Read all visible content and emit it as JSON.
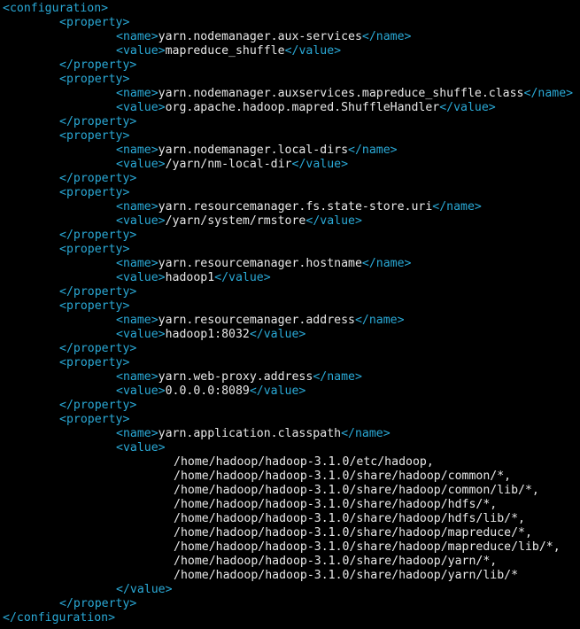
{
  "editor": {
    "root_open": "<configuration>",
    "root_close": "</configuration>",
    "prop_open": "<property>",
    "prop_close": "</property>",
    "name_open": "<name>",
    "name_close": "</name>",
    "value_open": "<value>",
    "value_close": "</value>",
    "properties": [
      {
        "name": "yarn.nodemanager.aux-services",
        "value": "mapreduce_shuffle"
      },
      {
        "name": "yarn.nodemanager.auxservices.mapreduce_shuffle.class",
        "value": "org.apache.hadoop.mapred.ShuffleHandler"
      },
      {
        "name": "yarn.nodemanager.local-dirs",
        "value": "/yarn/nm-local-dir"
      },
      {
        "name": "yarn.resourcemanager.fs.state-store.uri",
        "value": "/yarn/system/rmstore"
      },
      {
        "name": "yarn.resourcemanager.hostname",
        "value": "hadoop1"
      },
      {
        "name": "yarn.resourcemanager.address",
        "value": "hadoop1:8032"
      },
      {
        "name": "yarn.web-proxy.address",
        "value": "0.0.0.0:8089"
      }
    ],
    "classpath_property": {
      "name": "yarn.application.classpath",
      "value_lines": [
        "/home/hadoop/hadoop-3.1.0/etc/hadoop,",
        "/home/hadoop/hadoop-3.1.0/share/hadoop/common/*,",
        "/home/hadoop/hadoop-3.1.0/share/hadoop/common/lib/*,",
        "/home/hadoop/hadoop-3.1.0/share/hadoop/hdfs/*,",
        "/home/hadoop/hadoop-3.1.0/share/hadoop/hdfs/lib/*,",
        "/home/hadoop/hadoop-3.1.0/share/hadoop/mapreduce/*,",
        "/home/hadoop/hadoop-3.1.0/share/hadoop/mapreduce/lib/*,",
        "/home/hadoop/hadoop-3.1.0/share/hadoop/yarn/*,",
        "/home/hadoop/hadoop-3.1.0/share/hadoop/yarn/lib/*"
      ]
    },
    "colors": {
      "background": "#000000",
      "tag": "#2aa9d6",
      "text": "#e8e8e8"
    }
  }
}
